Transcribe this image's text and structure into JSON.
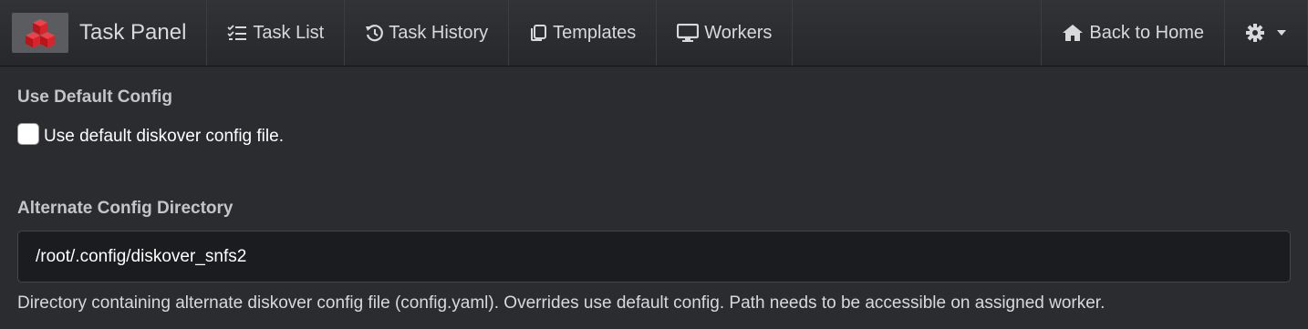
{
  "navbar": {
    "brand_title": "Task Panel",
    "items": [
      {
        "label": "Task List",
        "icon": "task-list-icon"
      },
      {
        "label": "Task History",
        "icon": "history-icon"
      },
      {
        "label": "Templates",
        "icon": "templates-icon"
      },
      {
        "label": "Workers",
        "icon": "monitor-icon"
      }
    ],
    "back_home_label": "Back to Home",
    "settings_icon": "gear-icon"
  },
  "form": {
    "default_config": {
      "title": "Use Default Config",
      "checkbox_label": "Use default diskover config file.",
      "checked": false
    },
    "alt_config": {
      "title": "Alternate Config Directory",
      "value": "/root/.config/diskover_snfs2",
      "help": "Directory containing alternate diskover config file (config.yaml). Overrides use default config. Path needs to be accessible on assigned worker."
    }
  },
  "colors": {
    "background": "#2a2c30",
    "navbar": "#2b2d31",
    "logo_red": "#d9232b",
    "input_bg": "#1b1c1f"
  }
}
